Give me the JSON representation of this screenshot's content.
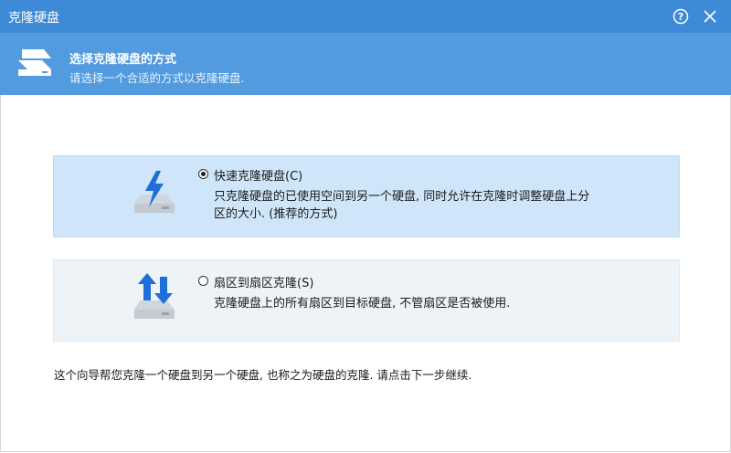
{
  "window": {
    "title": "克隆硬盘",
    "help_icon": "help-circle-icon",
    "close_icon": "close-icon"
  },
  "header": {
    "title": "选择克隆硬盘的方式",
    "subtitle": "请选择一个合适的方式以克隆硬盘."
  },
  "options": [
    {
      "label": "快速克隆硬盘(C)",
      "description": "只克隆硬盘的已使用空间到另一个硬盘, 同时允许在克隆时调整硬盘上分区的大小. (推荐的方式)",
      "selected": true,
      "icon": "disk-lightning-icon"
    },
    {
      "label": "扇区到扇区克隆(S)",
      "description": "克隆硬盘上的所有扇区到目标硬盘, 不管扇区是否被使用.",
      "selected": false,
      "icon": "disk-transfer-icon"
    }
  ],
  "footer_text": "这个向导帮您克隆一个硬盘到另一个硬盘, 也称之为硬盘的克隆. 请点击下一步继续.",
  "colors": {
    "titlebar": "#3e8ad6",
    "header": "#529bdf",
    "selected_option": "#cfe6fa",
    "unselected_option": "#eef3f8",
    "accent_blue": "#1e6fd9"
  }
}
